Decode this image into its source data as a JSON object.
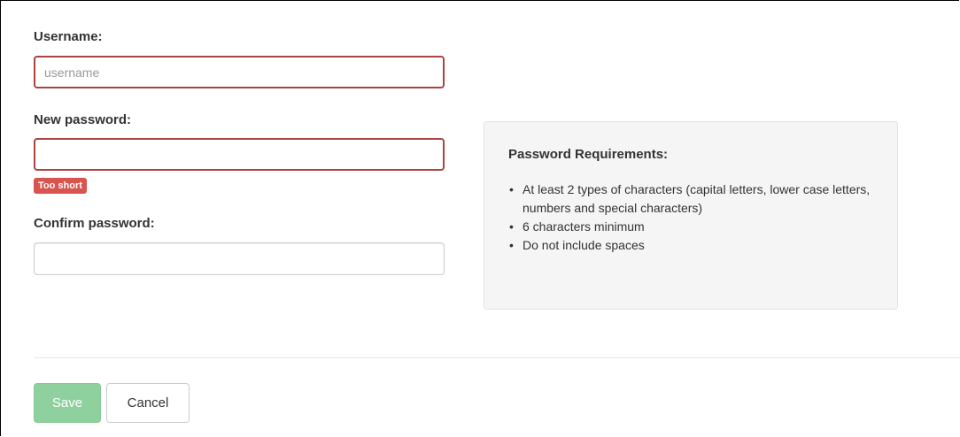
{
  "form": {
    "username": {
      "label": "Username:",
      "placeholder": "username",
      "value": ""
    },
    "new_password": {
      "label": "New password:",
      "value": "",
      "error_badge": "Too short"
    },
    "confirm_password": {
      "label": "Confirm password:",
      "value": ""
    }
  },
  "requirements": {
    "title": "Password Requirements:",
    "bullet": "•",
    "items": [
      "At least 2 types of characters (capital letters, lower case letters, numbers and special characters)",
      "6 characters minimum",
      "Do not include spaces"
    ]
  },
  "buttons": {
    "save_label": "Save",
    "cancel_label": "Cancel"
  },
  "colors": {
    "error_border": "#a94442",
    "error_badge": "#d9534f",
    "save_button": "#8fd19e",
    "panel_background": "#f5f5f5"
  }
}
